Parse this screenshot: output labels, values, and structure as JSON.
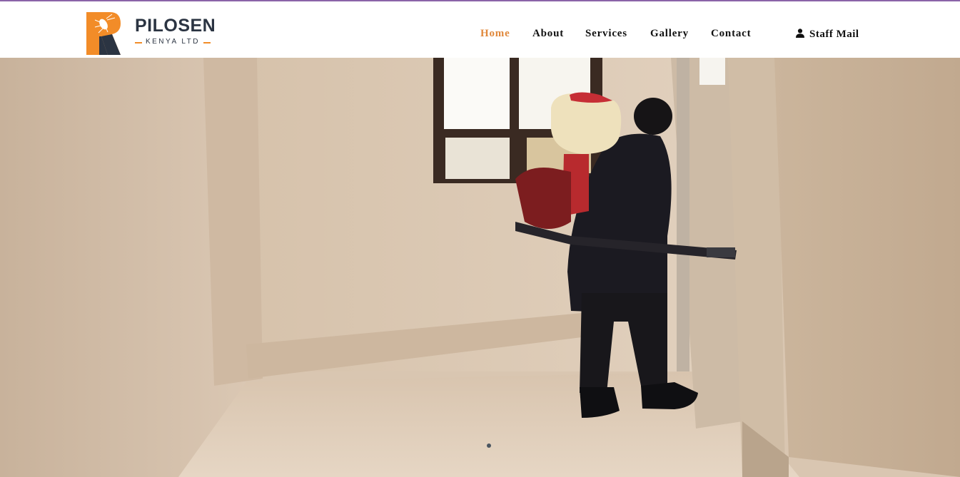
{
  "brand": {
    "name": "PILOSEN",
    "tagline": "KENYA LTD",
    "logo_icon": "cockroach-logo-icon",
    "colors": {
      "orange": "#f28c28",
      "navy": "#2b3442"
    }
  },
  "nav": {
    "items": [
      {
        "label": "Home",
        "active": true
      },
      {
        "label": "About",
        "active": false
      },
      {
        "label": "Services",
        "active": false
      },
      {
        "label": "Gallery",
        "active": false
      },
      {
        "label": "Contact",
        "active": false
      }
    ],
    "active_color": "#e0883b",
    "text_color": "#111111"
  },
  "staff_mail": {
    "icon": "user-icon",
    "label": "Staff Mail"
  },
  "hero": {
    "image": "photo of a pest control technician fogging an empty room",
    "slides": 1,
    "active_slide": 1
  }
}
